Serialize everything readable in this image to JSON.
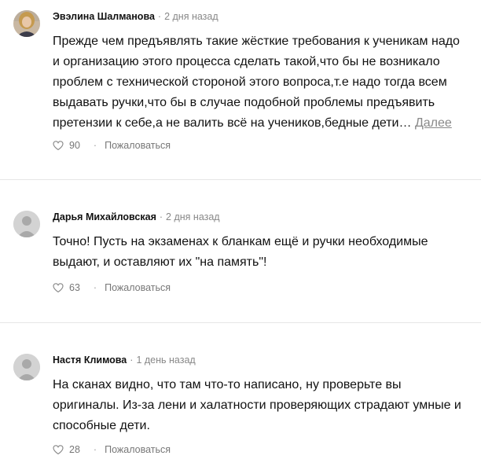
{
  "comments": [
    {
      "author": "Эвэлина Шалманова",
      "time": "2 дня назад",
      "text": "Прежде чем предъявлять такие жёсткие требования к ученикам надо и организацию этого процесса сделать такой,что бы не возникало проблем с технической стороной этого вопроса,т.е надо тогда всем выдавать ручки,что бы в случае подобной проблемы предъявить претензии к себе,а не валить всё на учеников,бедные дети…",
      "more_label": "Далее",
      "likes": "90",
      "report_label": "Пожаловаться",
      "avatar": "user-photo"
    },
    {
      "author": "Дарья Михайловская",
      "time": "2 дня назад",
      "text": "Точно! Пусть на экзаменах к бланкам ещё и ручки необходимые выдают, и оставляют их \"на память\"!",
      "likes": "63",
      "report_label": "Пожаловаться",
      "avatar": "default-avatar-icon"
    },
    {
      "author": "Настя Климова",
      "time": "1 день назад",
      "text": "На сканах видно, что там что-то написано, ну проверьте вы оригиналы. Из-за лени и халатности проверяющих страдают умные и способные дети.",
      "likes": "28",
      "report_label": "Пожаловаться",
      "avatar": "default-avatar-icon"
    }
  ],
  "meta_separator": "·",
  "colors": {
    "text": "#111111",
    "muted": "#888888",
    "divider": "#e6e6e6",
    "avatar_placeholder": "#d3d3d3"
  }
}
